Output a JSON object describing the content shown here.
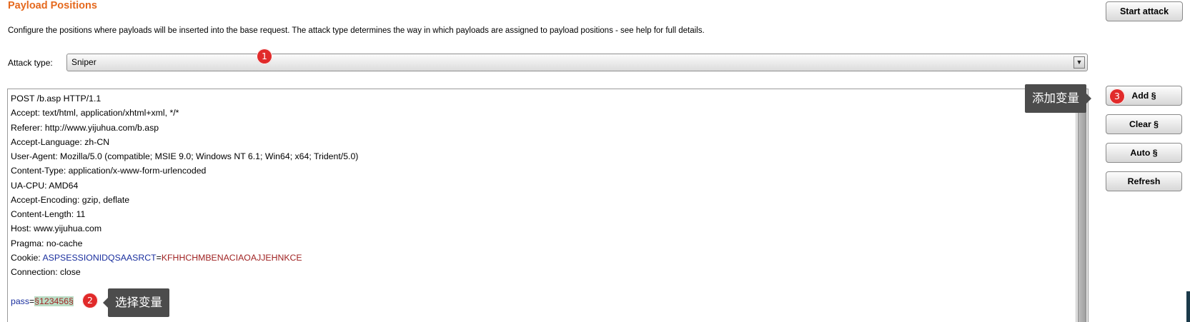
{
  "panel": {
    "title": "Payload Positions",
    "description": "Configure the positions where payloads will be inserted into the base request. The attack type determines the way in which payloads are assigned to payload positions - see help for full details."
  },
  "start_attack_label": "Start attack",
  "attack_type": {
    "label": "Attack type:",
    "value": "Sniper"
  },
  "request": {
    "lines": [
      "POST /b.asp HTTP/1.1",
      "Accept: text/html, application/xhtml+xml, */*",
      "Referer: http://www.yijuhua.com/b.asp",
      "Accept-Language: zh-CN",
      "User-Agent: Mozilla/5.0 (compatible; MSIE 9.0; Windows NT 6.1; Win64; x64; Trident/5.0)",
      "Content-Type: application/x-www-form-urlencoded",
      "UA-CPU: AMD64",
      "Accept-Encoding: gzip, deflate",
      "Content-Length: 11",
      "Host: www.yijuhua.com",
      "Pragma: no-cache"
    ],
    "cookie_prefix": "Cookie: ",
    "cookie_name": "ASPSESSIONIDQSAASRCT",
    "cookie_eq": "=",
    "cookie_value": "KFHHCHMBENACIAOAJJEHNKCE",
    "connection_line": "Connection: close",
    "body_name": "pass",
    "body_eq": "=",
    "body_payload": "§123456§"
  },
  "buttons": {
    "add": "Add §",
    "clear": "Clear §",
    "auto": "Auto §",
    "refresh": "Refresh"
  },
  "annotations": {
    "badge1": "1",
    "badge2": "2",
    "badge3": "3",
    "tip_select": "选择变量",
    "tip_add": "添加变量"
  },
  "colors": {
    "title": "#e5691e",
    "badge": "#e12a2a",
    "payload_highlight": "#b9dcc4",
    "param_name": "#1a2f9e",
    "param_value": "#a02424"
  }
}
